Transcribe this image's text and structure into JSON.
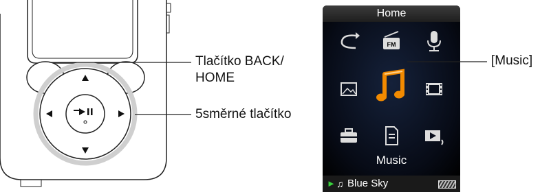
{
  "callouts": {
    "back_home_line1": "Tlačítko BACK/",
    "back_home_line2": "HOME",
    "five_way": "5směrné tlačítko",
    "music": "[Music]"
  },
  "screen": {
    "title": "Home",
    "caption": "Music",
    "status_track": "Blue Sky",
    "status_play_symbol": "►",
    "status_note_symbol": "♫"
  },
  "icons": [
    "repeat-icon",
    "fm-radio-icon",
    "microphone-icon",
    "photo-icon",
    "music-note-icon",
    "film-icon",
    "toolbox-icon",
    "document-icon",
    "now-playing-icon"
  ],
  "colors": {
    "highlight": "#f28a00",
    "status_play": "#39d23c",
    "screen_bg": "#000000"
  }
}
